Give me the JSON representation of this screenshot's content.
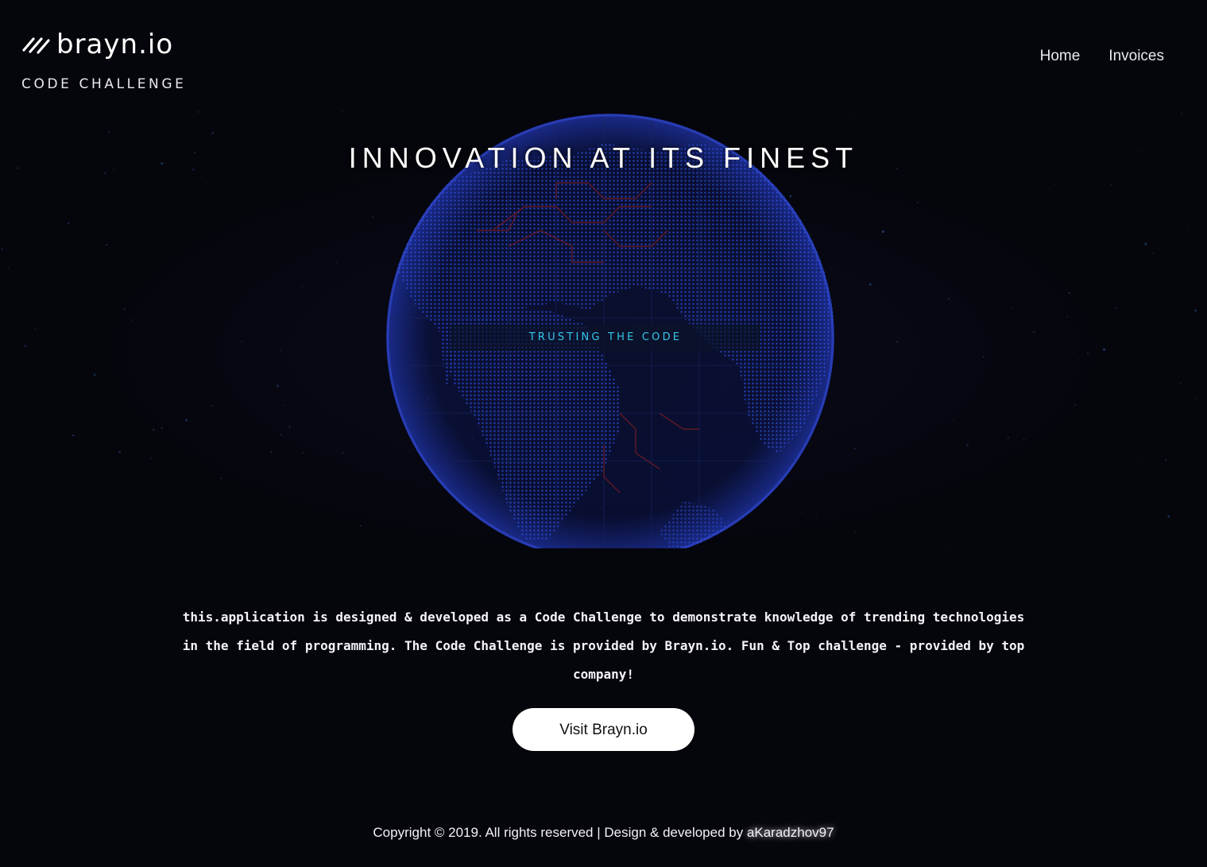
{
  "header": {
    "brand_name": "brayn.io",
    "brand_subtitle": "CODE CHALLENGE",
    "brand_icon": "brayn-slashes-logo",
    "nav": [
      {
        "label": "Home"
      },
      {
        "label": "Invoices"
      }
    ]
  },
  "hero": {
    "title": "INNOVATION AT ITS FINEST",
    "tagline": "TRUSTING THE CODE",
    "image": "dotted-globe-circuit"
  },
  "main": {
    "description": "this.application is designed & developed as a Code Challenge to demonstrate knowledge of trending technologies in the field of programming. The Code Challenge is provided by Brayn.io. Fun & Top challenge - provided by top company!",
    "cta_label": "Visit Brayn.io"
  },
  "footer": {
    "text": "Copyright © 2019. All rights reserved | Design & developed by ",
    "author": "aKaradzhov97"
  },
  "colors": {
    "background": "#05050c",
    "globe_blue": "#2b4bd6",
    "tagline_cyan": "#35c7ea",
    "circuit_red": "#6b1a24",
    "button_bg": "#ffffff"
  }
}
